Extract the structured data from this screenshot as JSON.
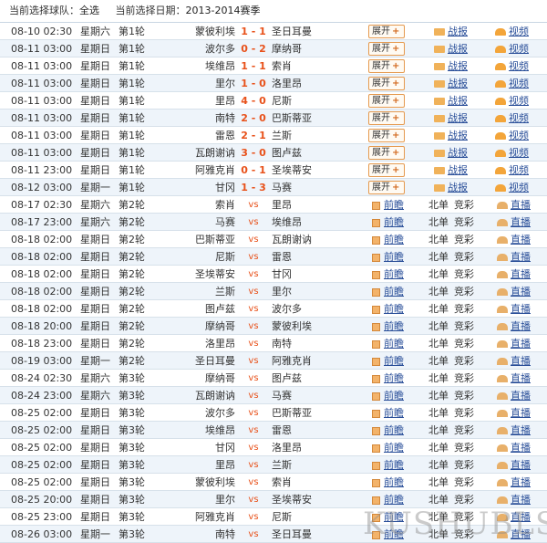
{
  "filter": {
    "team_label": "当前选择球队：",
    "team_value": "全选",
    "date_label": "当前选择日期：",
    "date_value": "2013-2014赛季"
  },
  "labels": {
    "expand": "展开",
    "plus": "+",
    "report": "战报",
    "video": "视频",
    "preview": "前瞻",
    "beidan": "北单",
    "jingcai": "竞彩",
    "live": "直播",
    "vs": "vs"
  },
  "matches": [
    {
      "date": "08-10 02:30",
      "weekday": "星期六",
      "round": "第1轮",
      "home": "蒙彼利埃",
      "score": "1 - 1",
      "away": "圣日耳曼",
      "played": true
    },
    {
      "date": "08-11 03:00",
      "weekday": "星期日",
      "round": "第1轮",
      "home": "波尔多",
      "score": "0 - 2",
      "away": "摩纳哥",
      "played": true
    },
    {
      "date": "08-11 03:00",
      "weekday": "星期日",
      "round": "第1轮",
      "home": "埃维昂",
      "score": "1 - 1",
      "away": "索肖",
      "played": true
    },
    {
      "date": "08-11 03:00",
      "weekday": "星期日",
      "round": "第1轮",
      "home": "里尔",
      "score": "1 - 0",
      "away": "洛里昂",
      "played": true
    },
    {
      "date": "08-11 03:00",
      "weekday": "星期日",
      "round": "第1轮",
      "home": "里昂",
      "score": "4 - 0",
      "away": "尼斯",
      "played": true
    },
    {
      "date": "08-11 03:00",
      "weekday": "星期日",
      "round": "第1轮",
      "home": "南特",
      "score": "2 - 0",
      "away": "巴斯蒂亚",
      "played": true
    },
    {
      "date": "08-11 03:00",
      "weekday": "星期日",
      "round": "第1轮",
      "home": "雷恩",
      "score": "2 - 1",
      "away": "兰斯",
      "played": true
    },
    {
      "date": "08-11 03:00",
      "weekday": "星期日",
      "round": "第1轮",
      "home": "瓦朗谢讷",
      "score": "3 - 0",
      "away": "图卢兹",
      "played": true
    },
    {
      "date": "08-11 23:00",
      "weekday": "星期日",
      "round": "第1轮",
      "home": "阿雅克肖",
      "score": "0 - 1",
      "away": "圣埃蒂安",
      "played": true
    },
    {
      "date": "08-12 03:00",
      "weekday": "星期一",
      "round": "第1轮",
      "home": "甘冈",
      "score": "1 - 3",
      "away": "马赛",
      "played": true
    },
    {
      "date": "08-17 02:30",
      "weekday": "星期六",
      "round": "第2轮",
      "home": "索肖",
      "score": "",
      "away": "里昂",
      "played": false
    },
    {
      "date": "08-17 23:00",
      "weekday": "星期六",
      "round": "第2轮",
      "home": "马赛",
      "score": "",
      "away": "埃维昂",
      "played": false
    },
    {
      "date": "08-18 02:00",
      "weekday": "星期日",
      "round": "第2轮",
      "home": "巴斯蒂亚",
      "score": "",
      "away": "瓦朗谢讷",
      "played": false
    },
    {
      "date": "08-18 02:00",
      "weekday": "星期日",
      "round": "第2轮",
      "home": "尼斯",
      "score": "",
      "away": "雷恩",
      "played": false
    },
    {
      "date": "08-18 02:00",
      "weekday": "星期日",
      "round": "第2轮",
      "home": "圣埃蒂安",
      "score": "",
      "away": "甘冈",
      "played": false
    },
    {
      "date": "08-18 02:00",
      "weekday": "星期日",
      "round": "第2轮",
      "home": "兰斯",
      "score": "",
      "away": "里尔",
      "played": false
    },
    {
      "date": "08-18 02:00",
      "weekday": "星期日",
      "round": "第2轮",
      "home": "图卢兹",
      "score": "",
      "away": "波尔多",
      "played": false
    },
    {
      "date": "08-18 20:00",
      "weekday": "星期日",
      "round": "第2轮",
      "home": "摩纳哥",
      "score": "",
      "away": "蒙彼利埃",
      "played": false
    },
    {
      "date": "08-18 23:00",
      "weekday": "星期日",
      "round": "第2轮",
      "home": "洛里昂",
      "score": "",
      "away": "南特",
      "played": false
    },
    {
      "date": "08-19 03:00",
      "weekday": "星期一",
      "round": "第2轮",
      "home": "圣日耳曼",
      "score": "",
      "away": "阿雅克肖",
      "played": false
    },
    {
      "date": "08-24 02:30",
      "weekday": "星期六",
      "round": "第3轮",
      "home": "摩纳哥",
      "score": "",
      "away": "图卢兹",
      "played": false
    },
    {
      "date": "08-24 23:00",
      "weekday": "星期六",
      "round": "第3轮",
      "home": "瓦朗谢讷",
      "score": "",
      "away": "马赛",
      "played": false
    },
    {
      "date": "08-25 02:00",
      "weekday": "星期日",
      "round": "第3轮",
      "home": "波尔多",
      "score": "",
      "away": "巴斯蒂亚",
      "played": false
    },
    {
      "date": "08-25 02:00",
      "weekday": "星期日",
      "round": "第3轮",
      "home": "埃维昂",
      "score": "",
      "away": "雷恩",
      "played": false
    },
    {
      "date": "08-25 02:00",
      "weekday": "星期日",
      "round": "第3轮",
      "home": "甘冈",
      "score": "",
      "away": "洛里昂",
      "played": false
    },
    {
      "date": "08-25 02:00",
      "weekday": "星期日",
      "round": "第3轮",
      "home": "里昂",
      "score": "",
      "away": "兰斯",
      "played": false
    },
    {
      "date": "08-25 02:00",
      "weekday": "星期日",
      "round": "第3轮",
      "home": "蒙彼利埃",
      "score": "",
      "away": "索肖",
      "played": false
    },
    {
      "date": "08-25 20:00",
      "weekday": "星期日",
      "round": "第3轮",
      "home": "里尔",
      "score": "",
      "away": "圣埃蒂安",
      "played": false
    },
    {
      "date": "08-25 23:00",
      "weekday": "星期日",
      "round": "第3轮",
      "home": "阿雅克肖",
      "score": "",
      "away": "尼斯",
      "played": false
    },
    {
      "date": "08-26 03:00",
      "weekday": "星期一",
      "round": "第3轮",
      "home": "南特",
      "score": "",
      "away": "圣日耳曼",
      "played": false
    }
  ],
  "watermark": "KUSHUBLS"
}
